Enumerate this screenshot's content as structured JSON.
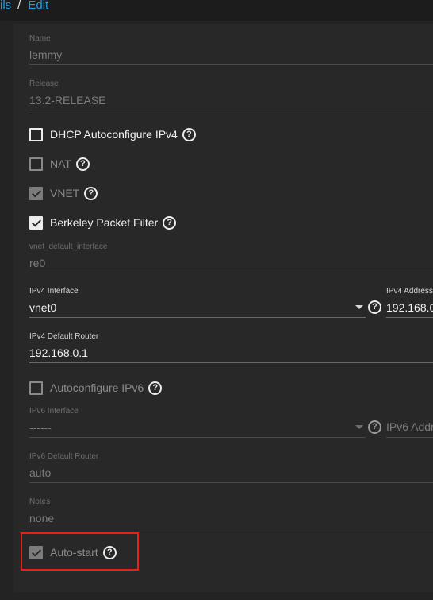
{
  "breadcrumb": {
    "parent": "ils",
    "separator": "/",
    "current": "Edit"
  },
  "fields": {
    "name": {
      "label": "Name",
      "value": "lemmy"
    },
    "release": {
      "label": "Release",
      "value": "13.2-RELEASE"
    },
    "vnet_default_interface": {
      "label": "vnet_default_interface",
      "value": "re0"
    },
    "ipv4_interface": {
      "label": "IPv4 Interface",
      "value": "vnet0"
    },
    "ipv4_address": {
      "label": "IPv4 Address",
      "value": "192.168.0"
    },
    "ipv4_default_router": {
      "label": "IPv4 Default Router",
      "value": "192.168.0.1"
    },
    "ipv6_interface": {
      "label": "IPv6 Interface",
      "value": "------"
    },
    "ipv6_address": {
      "placeholder": "IPv6 Addr"
    },
    "ipv6_default_router": {
      "label": "IPv6 Default Router",
      "value": "auto"
    },
    "notes": {
      "label": "Notes",
      "value": "none"
    }
  },
  "checkboxes": {
    "dhcp": {
      "label": "DHCP Autoconfigure IPv4",
      "checked": false,
      "disabled": false
    },
    "nat": {
      "label": "NAT",
      "checked": false,
      "disabled": true
    },
    "vnet": {
      "label": "VNET",
      "checked": true,
      "disabled": true
    },
    "bpf": {
      "label": "Berkeley Packet Filter",
      "checked": true,
      "disabled": false
    },
    "autoconf_ipv6": {
      "label": "Autoconfigure IPv6",
      "checked": false,
      "disabled": false
    },
    "autostart": {
      "label": "Auto-start",
      "checked": true,
      "disabled": true
    }
  },
  "help_glyph": "?",
  "colors": {
    "link": "#1e9de0",
    "highlight": "#e3231b",
    "background": "#282828"
  }
}
